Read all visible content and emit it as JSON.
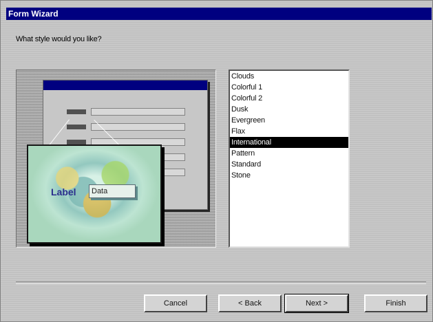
{
  "window": {
    "title": "Form Wizard",
    "prompt": "What style would you like?"
  },
  "styles": {
    "selected": "International",
    "items": [
      "Clouds",
      "Colorful 1",
      "Colorful 2",
      "Dusk",
      "Evergreen",
      "Flax",
      "International",
      "Pattern",
      "Standard",
      "Stone"
    ]
  },
  "preview": {
    "label": "Label",
    "data": "Data"
  },
  "buttons": {
    "cancel": "Cancel",
    "back": "< Back",
    "next": "Next >",
    "finish": "Finish"
  },
  "colors": {
    "titlebar": "#000080",
    "window": "#c8c8c8",
    "selected_background": "#000000",
    "selected_text": "#ffffff"
  }
}
